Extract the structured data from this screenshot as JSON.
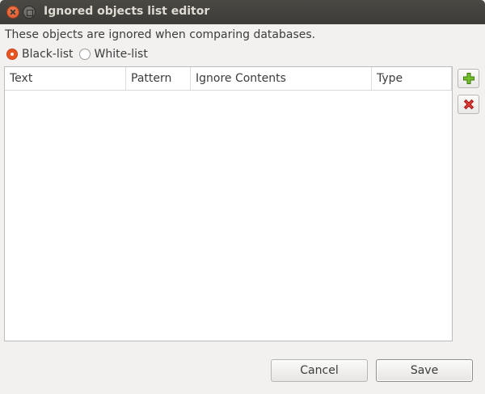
{
  "window": {
    "title": "Ignored objects list editor"
  },
  "description": "These objects are ignored when comparing databases.",
  "list_mode": {
    "options": [
      "Black-list",
      "White-list"
    ],
    "selected": "Black-list"
  },
  "table": {
    "columns": [
      "Text",
      "Pattern",
      "Ignore Contents",
      "Type"
    ],
    "rows": []
  },
  "side_buttons": {
    "add_icon": "add-icon",
    "remove_icon": "remove-icon",
    "add_color": "#4e9a06",
    "remove_color": "#cc0000"
  },
  "buttons": {
    "cancel": "Cancel",
    "save": "Save"
  },
  "colors": {
    "accent": "#e95420",
    "titlebar": "#3c3b37"
  }
}
